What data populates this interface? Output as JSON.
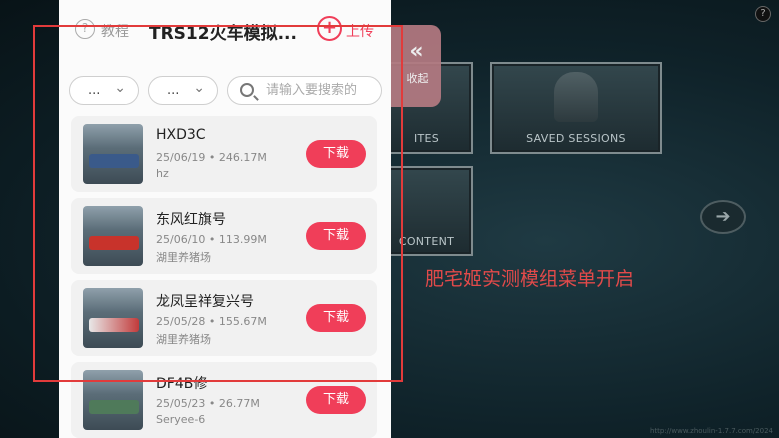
{
  "game": {
    "help_label": "?",
    "tile_sessions_label": "SAVED SESSIONS",
    "tile_routes_label": "ITES",
    "tile_content_label": "CONTENT",
    "arrow_icon": "arrow-right-icon",
    "caption": "肥宅姬实测模组菜单开启",
    "watermark": "http://www.zhoulin-1.7.7.com/2024"
  },
  "collapse": {
    "chev": "«",
    "label": "收起"
  },
  "panel": {
    "tutorial_icon": "?",
    "tutorial_label": "教程",
    "title": "TRS12火车模拟...",
    "upload_icon": "+",
    "upload_label": "上传",
    "filters": [
      {
        "value": "..."
      },
      {
        "value": "..."
      }
    ],
    "search_placeholder": "请输入要搜索的"
  },
  "mods": [
    {
      "name": "HXD3C",
      "date": "25/06/19",
      "size": "246.17M",
      "author": "hz",
      "button": "下载"
    },
    {
      "name": "东风红旗号",
      "date": "25/06/10",
      "size": "113.99M",
      "author": "湖里养猪场",
      "button": "下载"
    },
    {
      "name": "龙凤呈祥复兴号",
      "date": "25/05/28",
      "size": "155.67M",
      "author": "湖里养猪场",
      "button": "下载"
    },
    {
      "name": "DF4B修",
      "date": "25/05/23",
      "size": "26.77M",
      "author": "Seryee-6",
      "button": "下载"
    }
  ],
  "colors": {
    "accent": "#f03e59",
    "annotation": "#e23b3b",
    "caption": "#e24a4a"
  }
}
